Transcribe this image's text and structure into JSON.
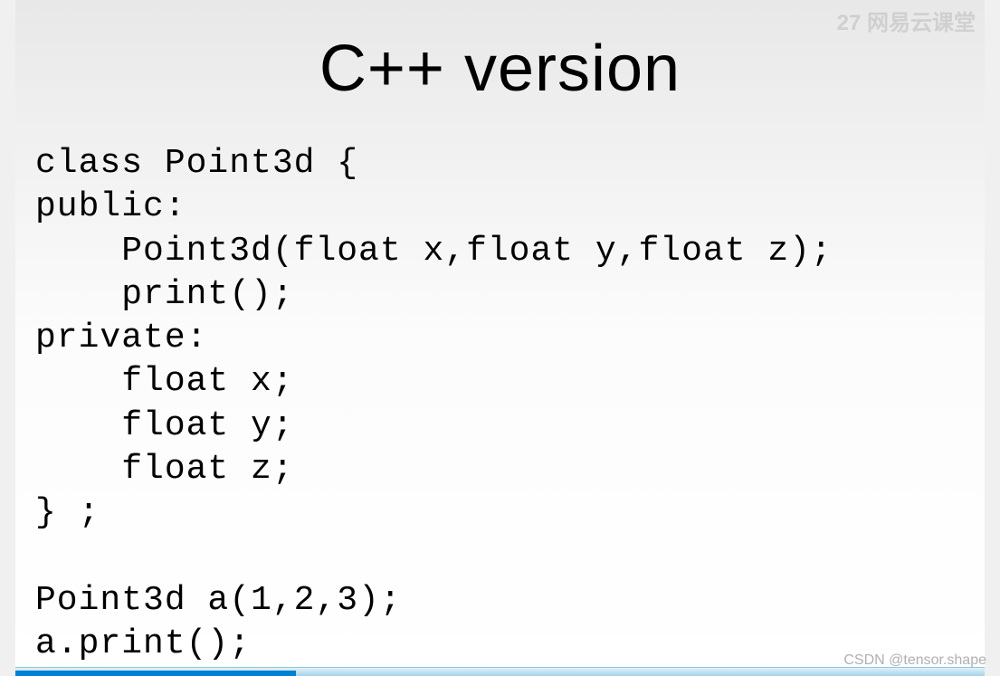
{
  "slide": {
    "title": "C++ version",
    "code": "class Point3d {\npublic:\n    Point3d(float x,float y,float z);\n    print();\nprivate:\n    float x;\n    float y;\n    float z;\n} ;\n\nPoint3d a(1,2,3);\na.print();"
  },
  "watermark": {
    "top_right": "27 网易云课堂",
    "bottom_right": "CSDN @tensor.shape"
  }
}
